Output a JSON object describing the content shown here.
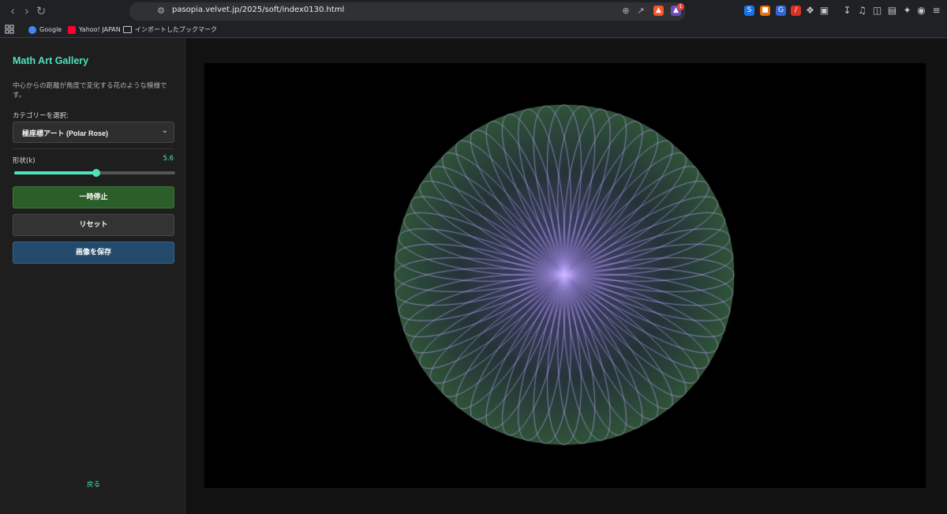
{
  "browser": {
    "url": "pasopia.velvet.jp/2025/soft/index0130.html",
    "bookmarks": [
      {
        "label": "Google",
        "icon": "google-icon",
        "color": "#4285f4"
      },
      {
        "label": "Yahoo! JAPAN",
        "icon": "yahoo-icon",
        "color": "#ff0033"
      },
      {
        "label": "インポートしたブックマーク",
        "icon": "folder-icon",
        "color": "#c4c7cc"
      }
    ],
    "notification_badge": "1"
  },
  "sidebar": {
    "title": "Math Art Gallery",
    "description": "中心からの距離が角度で変化する花のような模様です。",
    "category_label": "カテゴリーを選択:",
    "category_selected": "極座標アート (Polar Rose)",
    "param_label": "形状(k)",
    "param_value": "5.6",
    "param_min": 1,
    "param_max": 10,
    "pause_label": "一時停止",
    "reset_label": "リセット",
    "save_label": "画像を保存",
    "back_label": "戻る"
  },
  "colors": {
    "accent": "#4ee3bd",
    "pause": "#2c5e2a",
    "save": "#234a6b",
    "petal": "#a58cf0",
    "fill": "#2e5a3c"
  },
  "art": {
    "curve": "polar-rose",
    "k": 5.6
  }
}
